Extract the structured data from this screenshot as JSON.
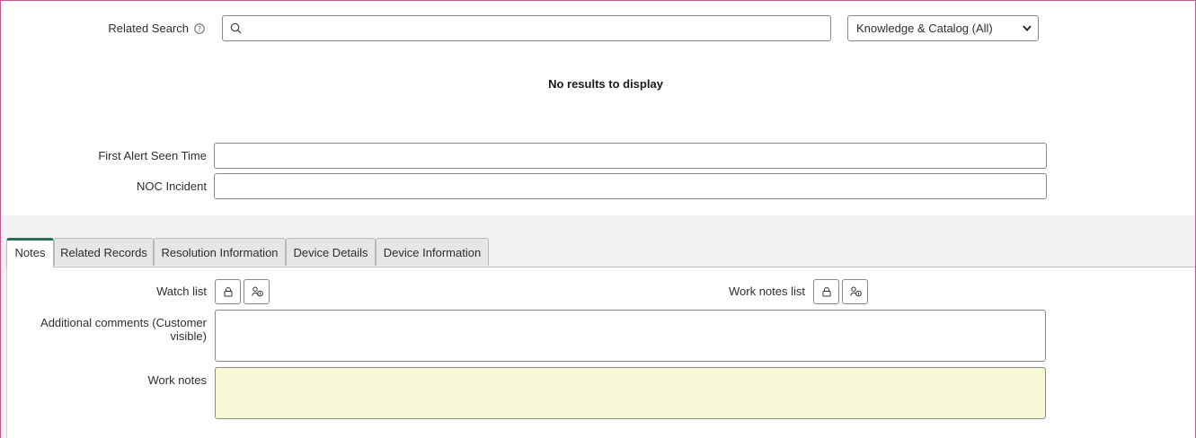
{
  "related_search": {
    "label": "Related Search",
    "search_value": "",
    "scope_selected": "Knowledge & Catalog (All)",
    "no_results": "No results to display"
  },
  "fields": {
    "first_alert_label": "First Alert Seen Time",
    "first_alert_value": "",
    "noc_incident_label": "NOC Incident",
    "noc_incident_value": ""
  },
  "tabs": [
    {
      "label": "Notes"
    },
    {
      "label": "Related Records"
    },
    {
      "label": "Resolution Information"
    },
    {
      "label": "Device Details"
    },
    {
      "label": "Device Information"
    }
  ],
  "notes": {
    "watch_list_label": "Watch list",
    "work_notes_list_label": "Work notes list",
    "additional_comments_label_line1": "Additional comments (Customer",
    "additional_comments_label_line2": "visible",
    "additional_comments_label_line2_close": ")",
    "work_notes_label": "Work notes"
  },
  "colors": {
    "frame_border": "#c3578f",
    "active_tab_accent": "#2a6c5a",
    "work_notes_bg": "#f7f8d5"
  },
  "icons": {
    "search": "search-icon",
    "help": "help-icon",
    "lock": "lock-icon",
    "add_me": "add-me-icon",
    "dropdown": "chevron-down-icon"
  }
}
